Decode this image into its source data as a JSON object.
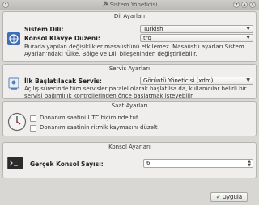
{
  "window": {
    "title": "Sistem Yöneticisi"
  },
  "language_panel": {
    "title": "Dil Ayarları",
    "system_language_label": "Sistem Dili:",
    "system_language_value": "Turkish",
    "keyboard_label": "Konsol Klavye Düzeni:",
    "keyboard_value": "trq",
    "note": "Burada yapılan değişiklikler masaüstünü etkilemez. Masaüstü ayarları Sistem Ayarları'ndaki 'Ülke, Bölge ve Dil' bileşeninden değiştirilebilir."
  },
  "services_panel": {
    "title": "Servis Ayarları",
    "first_service_label": "İlk Başlatılacak Servis:",
    "first_service_value": "Görüntü Yöneticisi (xdm)",
    "note": "Açılış sürecinde tüm servisler paralel olarak başlatılsa da, kullanıcılar belirli bir servisi bağımlılık kontrollerinden önce başlatmak isteyebilir."
  },
  "time_panel": {
    "title": "Saat Ayarları",
    "utc_label": "Donanım saatini UTC biçiminde tut",
    "utc_checked": false,
    "drift_label": "Donanım saatinin ritmik kaymasını düzelt",
    "drift_checked": false
  },
  "console_panel": {
    "title": "Konsol Ayarları",
    "count_label": "Gerçek Konsol Sayısı:",
    "count_value": "6"
  },
  "footer": {
    "apply_label": "Uygula"
  },
  "colors": {
    "window_bg": "#d9d7d3",
    "panel_bg": "#efeeec",
    "apply_check": "#3a9a2a"
  }
}
